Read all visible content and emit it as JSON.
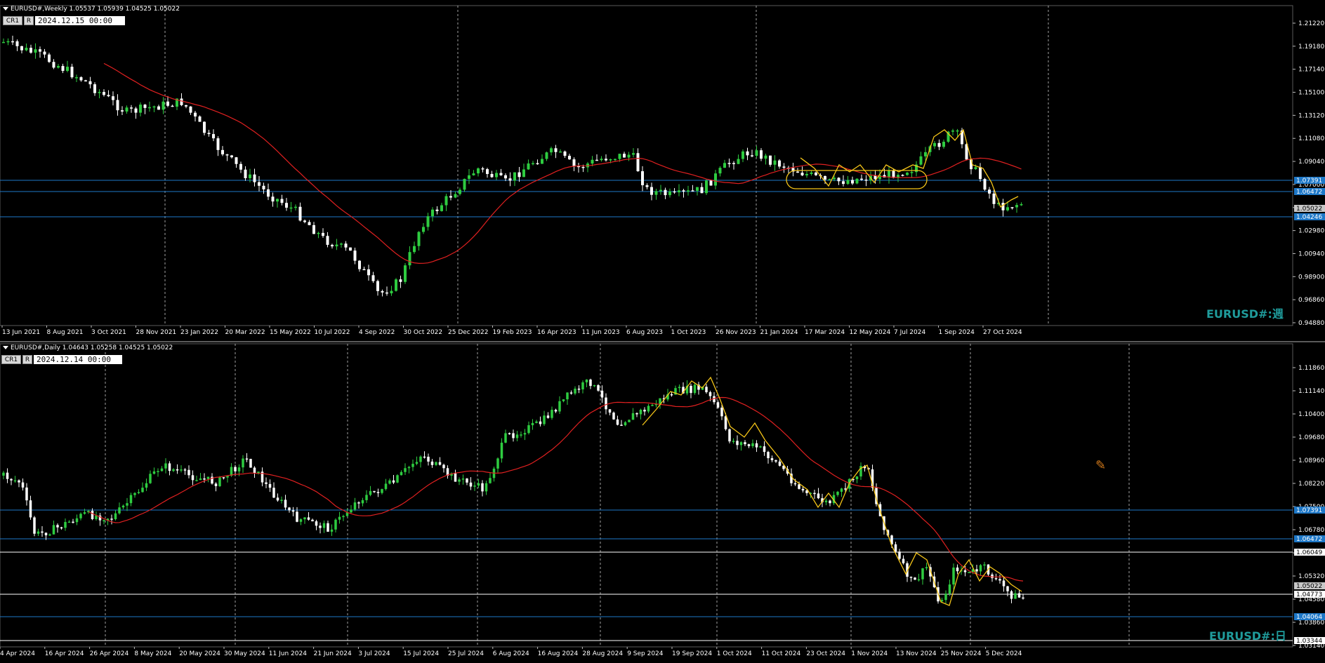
{
  "top_chart": {
    "header": "EURUSD#,Weekly  1.05537 1.05939 1.04525 1.05022",
    "btn_cr": "CR1",
    "btn_r": "R",
    "cursor_date": "2024.12.15 00:00",
    "watermark": "EURUSD#:週",
    "price_labels": [
      "1.21220",
      "1.19180",
      "1.17140",
      "1.15100",
      "1.13120",
      "1.11080",
      "1.09040",
      "1.07000",
      "1.04960",
      "1.02980",
      "1.00940",
      "0.98900",
      "0.96860",
      "0.94880"
    ],
    "hlines": [
      {
        "price": "1.07391",
        "color": "#1e78c8",
        "label_bg": "#1e78c8"
      },
      {
        "price": "1.06472",
        "color": "#1e78c8",
        "label_bg": "#1e78c8"
      },
      {
        "price": "1.04246",
        "color": "#1e78c8",
        "label_bg": "#1e78c8"
      }
    ],
    "current_price": "1.05022",
    "date_labels": [
      "13 Jun 2021",
      "8 Aug 2021",
      "3 Oct 2021",
      "28 Nov 2021",
      "23 Jan 2022",
      "20 Mar 2022",
      "15 May 2022",
      "10 Jul 2022",
      "4 Sep 2022",
      "30 Oct 2022",
      "25 Dec 2022",
      "19 Feb 2023",
      "16 Apr 2023",
      "11 Jun 2023",
      "6 Aug 2023",
      "1 Oct 2023",
      "26 Nov 2023",
      "21 Jan 2024",
      "17 Mar 2024",
      "12 May 2024",
      "7 Jul 2024",
      "1 Sep 2024",
      "27 Oct 2024"
    ]
  },
  "bottom_chart": {
    "header": "EURUSD#,Daily  1.04643 1.05258 1.04525 1.05022",
    "btn_cr": "CR1",
    "btn_r": "R",
    "cursor_date": "2024.12.14 00:00",
    "watermark": "EURUSD#:日",
    "price_labels": [
      "1.11860",
      "1.11140",
      "1.10400",
      "1.09680",
      "1.08960",
      "1.08220",
      "1.07500",
      "1.06780",
      "1.06040",
      "1.05320",
      "1.04580",
      "1.03860",
      "1.03140"
    ],
    "hlines": [
      {
        "price": "1.07391",
        "color": "#1e78c8",
        "label_bg": "#1e78c8"
      },
      {
        "price": "1.06472",
        "color": "#1e78c8",
        "label_bg": "#1e78c8"
      },
      {
        "price": "1.06049",
        "color": "#ffffff",
        "label_bg": "#ffffff"
      },
      {
        "price": "1.04773",
        "color": "#ffffff",
        "label_bg": "#ffffff"
      },
      {
        "price": "1.04064",
        "color": "#1e78c8",
        "label_bg": "#1e78c8"
      },
      {
        "price": "1.03344",
        "color": "#ffffff",
        "label_bg": "#ffffff"
      }
    ],
    "current_price": "1.05022",
    "date_labels": [
      "4 Apr 2024",
      "16 Apr 2024",
      "26 Apr 2024",
      "8 May 2024",
      "20 May 2024",
      "30 May 2024",
      "11 Jun 2024",
      "21 Jun 2024",
      "3 Jul 2024",
      "15 Jul 2024",
      "25 Jul 2024",
      "6 Aug 2024",
      "16 Aug 2024",
      "28 Aug 2024",
      "9 Sep 2024",
      "19 Sep 2024",
      "1 Oct 2024",
      "11 Oct 2024",
      "23 Oct 2024",
      "1 Nov 2024",
      "13 Nov 2024",
      "25 Nov 2024",
      "5 Dec 2024"
    ]
  },
  "colors": {
    "bull": "#2ecc40",
    "bear": "#ffffff",
    "ma": "#e02020",
    "zigzag": "#f5c518",
    "grid": "#c8c8c8",
    "hline_blue": "#1e78c8",
    "watermark": "#1f9b9b"
  },
  "icons": {
    "cursor": "crosshair-pencil-icon"
  }
}
